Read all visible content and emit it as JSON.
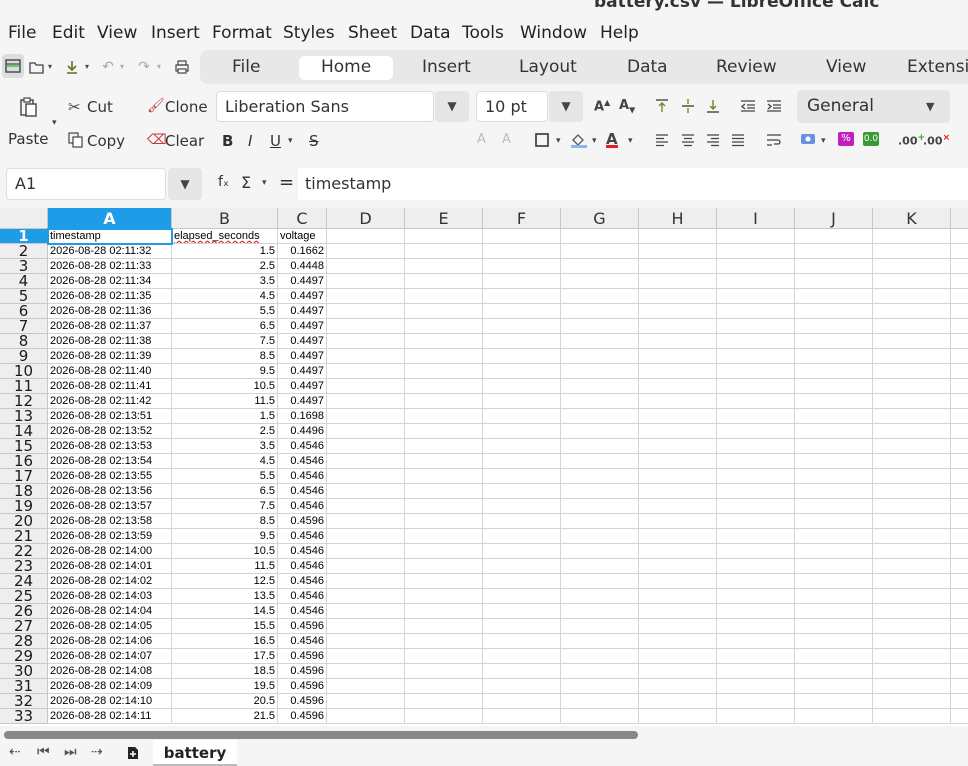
{
  "window": {
    "title": "battery.csv — LibreOffice Calc"
  },
  "menu": [
    "File",
    "Edit",
    "View",
    "Insert",
    "Format",
    "Styles",
    "Sheet",
    "Data",
    "Tools",
    "Window",
    "Help"
  ],
  "tabs": [
    "File",
    "Home",
    "Insert",
    "Layout",
    "Data",
    "Review",
    "View",
    "Extensio"
  ],
  "active_tab": "Home",
  "toolbar": {
    "paste": "Paste",
    "cut": "Cut",
    "copy": "Copy",
    "clone": "Clone",
    "clear": "Clear",
    "font_name": "Liberation Sans",
    "font_size": "10 pt",
    "number_format": "General",
    "bold": "B",
    "italic": "I",
    "underline": "U",
    "strike": "S"
  },
  "formula_bar": {
    "cell_ref": "A1",
    "fx": "fₓ",
    "sigma": "Σ",
    "equals": "=",
    "content": "timestamp"
  },
  "columns": [
    "A",
    "B",
    "C",
    "D",
    "E",
    "F",
    "G",
    "H",
    "I",
    "J",
    "K"
  ],
  "selected_column": "A",
  "row_numbers": [
    "1",
    "2",
    "3",
    "4",
    "5",
    "6",
    "7",
    "8",
    "9",
    "10",
    "11",
    "12",
    "13",
    "14",
    "15",
    "16",
    "17",
    "18",
    "19",
    "20",
    "21",
    "22",
    "23",
    "24",
    "25",
    "26",
    "27",
    "28",
    "29",
    "30",
    "31",
    "32",
    "33"
  ],
  "headers": [
    "timestamp",
    "elapsed_seconds",
    "voltage"
  ],
  "rows": [
    [
      "2026-08-28 02:11:32",
      "1.5",
      "0.1662"
    ],
    [
      "2026-08-28 02:11:33",
      "2.5",
      "0.4448"
    ],
    [
      "2026-08-28 02:11:34",
      "3.5",
      "0.4497"
    ],
    [
      "2026-08-28 02:11:35",
      "4.5",
      "0.4497"
    ],
    [
      "2026-08-28 02:11:36",
      "5.5",
      "0.4497"
    ],
    [
      "2026-08-28 02:11:37",
      "6.5",
      "0.4497"
    ],
    [
      "2026-08-28 02:11:38",
      "7.5",
      "0.4497"
    ],
    [
      "2026-08-28 02:11:39",
      "8.5",
      "0.4497"
    ],
    [
      "2026-08-28 02:11:40",
      "9.5",
      "0.4497"
    ],
    [
      "2026-08-28 02:11:41",
      "10.5",
      "0.4497"
    ],
    [
      "2026-08-28 02:11:42",
      "11.5",
      "0.4497"
    ],
    [
      "2026-08-28 02:13:51",
      "1.5",
      "0.1698"
    ],
    [
      "2026-08-28 02:13:52",
      "2.5",
      "0.4496"
    ],
    [
      "2026-08-28 02:13:53",
      "3.5",
      "0.4546"
    ],
    [
      "2026-08-28 02:13:54",
      "4.5",
      "0.4546"
    ],
    [
      "2026-08-28 02:13:55",
      "5.5",
      "0.4546"
    ],
    [
      "2026-08-28 02:13:56",
      "6.5",
      "0.4546"
    ],
    [
      "2026-08-28 02:13:57",
      "7.5",
      "0.4546"
    ],
    [
      "2026-08-28 02:13:58",
      "8.5",
      "0.4596"
    ],
    [
      "2026-08-28 02:13:59",
      "9.5",
      "0.4546"
    ],
    [
      "2026-08-28 02:14:00",
      "10.5",
      "0.4546"
    ],
    [
      "2026-08-28 02:14:01",
      "11.5",
      "0.4546"
    ],
    [
      "2026-08-28 02:14:02",
      "12.5",
      "0.4546"
    ],
    [
      "2026-08-28 02:14:03",
      "13.5",
      "0.4546"
    ],
    [
      "2026-08-28 02:14:04",
      "14.5",
      "0.4546"
    ],
    [
      "2026-08-28 02:14:05",
      "15.5",
      "0.4596"
    ],
    [
      "2026-08-28 02:14:06",
      "16.5",
      "0.4546"
    ],
    [
      "2026-08-28 02:14:07",
      "17.5",
      "0.4596"
    ],
    [
      "2026-08-28 02:14:08",
      "18.5",
      "0.4596"
    ],
    [
      "2026-08-28 02:14:09",
      "19.5",
      "0.4596"
    ],
    [
      "2026-08-28 02:14:10",
      "20.5",
      "0.4596"
    ],
    [
      "2026-08-28 02:14:11",
      "21.5",
      "0.4596"
    ]
  ],
  "sheet_tabs": [
    "battery"
  ],
  "colors": {
    "accent": "#1e9ce8",
    "font_color": "#e02020",
    "percent": "#c020c0",
    "decimal": "#3a9a3a"
  }
}
